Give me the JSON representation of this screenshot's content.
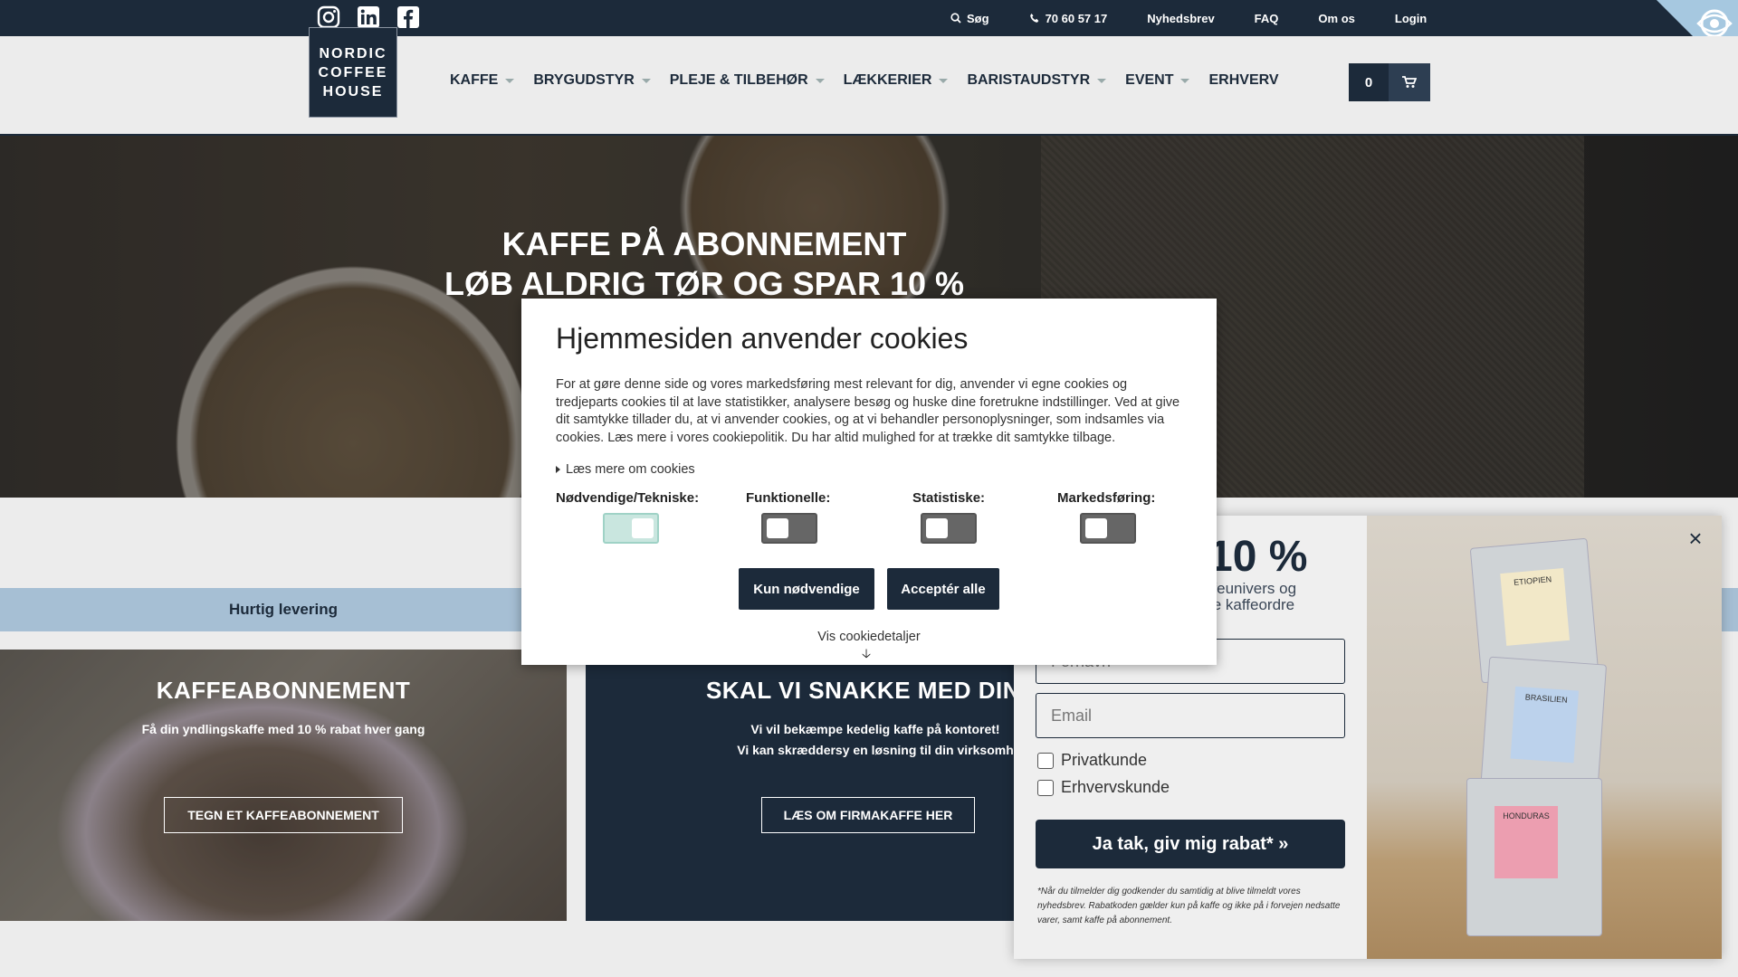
{
  "topbar": {
    "social": [
      "instagram-icon",
      "linkedin-icon",
      "facebook-icon"
    ],
    "search_label": "Søg",
    "phone": "70 60 57 17",
    "newsletter": "Nyhedsbrev",
    "faq": "FAQ",
    "about": "Om os",
    "login": "Login"
  },
  "logo": {
    "line1": "NORDIC",
    "line2": "COFFEE",
    "line3": "HOUSE"
  },
  "nav": [
    {
      "label": "KAFFE"
    },
    {
      "label": "BRYGUDSTYR"
    },
    {
      "label": "PLEJE & TILBEHØR"
    },
    {
      "label": "LÆKKERIER"
    },
    {
      "label": "BARISTAUDSTYR"
    },
    {
      "label": "EVENT"
    },
    {
      "label": "ERHVERV"
    }
  ],
  "cart": {
    "count": "0"
  },
  "hero": {
    "line1": "KAFFE PÅ ABONNEMENT",
    "line2": "LØB ALDRIG TØR OG SPAR 10 %"
  },
  "usp": {
    "label": "Hurtig levering"
  },
  "cards": {
    "left": {
      "title": "KAFFEABONNEMENT",
      "sub": "Få din yndlingskaffe med 10 % rabat hver gang",
      "button": "TEGN ET KAFFEABONNEMENT"
    },
    "right": {
      "title": "SKAL VI SNAKKE MED DIN C",
      "sub1": "Vi vil bekæmpe kedelig kaffe på kontoret!",
      "sub2": "Vi kan skræddersy en løsning til din virksomh",
      "button": "LÆS OM FIRMAKAFFE HER"
    }
  },
  "newsletter": {
    "big": "10 %",
    "small1": "ffeunivers og",
    "small2": "te kaffeordre",
    "firstname_placeholder": "Fornavn",
    "email_placeholder": "Email",
    "check1": "Privatkunde",
    "check2": "Erhvervskunde",
    "button": "Ja tak, giv mig rabat* »",
    "fine": "*Når du tilmelder dig godkender du samtidig at blive tilmeldt vores nyhedsbrev. Rabatkoden gælder kun på kaffe og ikke på i forvejen nedsatte varer, samt kaffe på abonnement.",
    "bags": [
      "ETIOPIEN",
      "BRASILIEN",
      "HONDURAS"
    ]
  },
  "cookie": {
    "title": "Hjemmesiden anvender cookies",
    "text": "For at gøre denne side og vores markedsføring mest relevant for dig, anvender vi egne cookies og tredjeparts cookies til at lave statistikker, analysere besøg og huske dine foretrukne indstillinger. Ved at give dit samtykke tillader du, at vi anvender cookies, og at vi behandler personoplysninger, som indsamles via cookies. Læs mere i vores cookiepolitik. Du har altid mulighed for at trække dit samtykke tilbage.",
    "more": "Læs mere om cookies",
    "categories": [
      {
        "label": "Nødvendige/Tekniske:",
        "enabled": true
      },
      {
        "label": "Funktionelle:",
        "enabled": false
      },
      {
        "label": "Statistiske:",
        "enabled": false
      },
      {
        "label": "Markedsføring:",
        "enabled": false
      }
    ],
    "btn_necessary": "Kun nødvendige",
    "btn_accept": "Acceptér alle",
    "details": "Vis cookiedetaljer"
  },
  "colors": {
    "navy": "#1c2a3a",
    "usp_band": "#a6bfd4",
    "toggle_on": "#c9e6df"
  }
}
